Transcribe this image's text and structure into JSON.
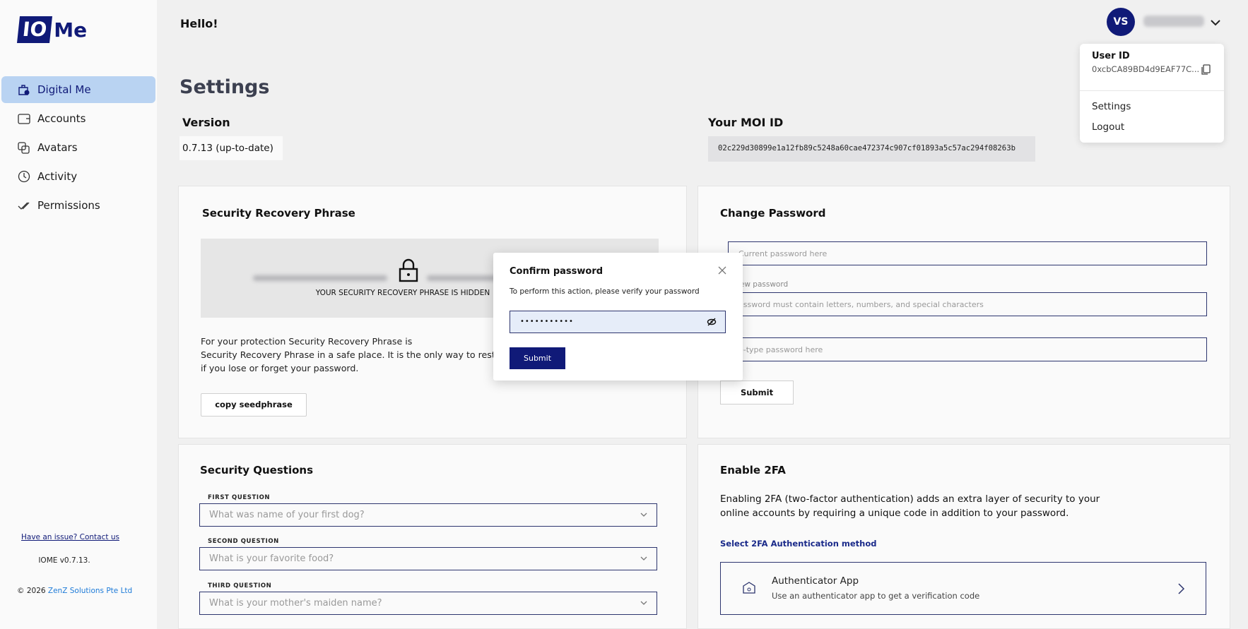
{
  "brand": {
    "logo_box": "IO",
    "logo_text": "Me"
  },
  "sidebar": {
    "items": [
      {
        "label": "Digital Me",
        "icon": "digital-me-icon",
        "active": true
      },
      {
        "label": "Accounts",
        "icon": "wallet-icon"
      },
      {
        "label": "Avatars",
        "icon": "avatars-icon"
      },
      {
        "label": "Activity",
        "icon": "clock-icon"
      },
      {
        "label": "Permissions",
        "icon": "check-icon"
      }
    ],
    "contact": "Have an issue? Contact us",
    "version": "IOME v0.7.13.",
    "copyright_prefix": "© 2026 ",
    "company": "ZenZ Solutions Pte Ltd"
  },
  "header": {
    "greeting": "Hello!",
    "avatar_initials": "VS"
  },
  "user_menu": {
    "id_label": "User ID",
    "id_value": "0xcbCA89BD4d9EAF77C...",
    "items": [
      "Settings",
      "Logout"
    ]
  },
  "settings": {
    "title": "Settings",
    "version_label": "Version",
    "version_value": "0.7.13 (up-to-date)",
    "moi_label": "Your MOI ID",
    "moi_value": "02c229d30899e1a12fb89c5248a60cae472374c907cf01893a5c57ac294f08263b"
  },
  "recovery": {
    "title": "Security Recovery Phrase",
    "hidden_label": "YOUR SECURITY RECOVERY PHRASE IS HIDDEN",
    "text_line1": "For your protection Security Recovery Phrase is",
    "text_line2": "Security Recovery Phrase in a safe place. It is the only way to restore yo",
    "text_line3": "if you lose or forget your password.",
    "copy_button": "copy seedphrase"
  },
  "change_password": {
    "title": "Change Password",
    "current_placeholder": "Current password here",
    "new_label": "lew password",
    "new_placeholder": "assword must contain letters, numbers, and special characters",
    "retype_placeholder": "e-type password here",
    "submit": "Submit"
  },
  "questions": {
    "title": "Security Questions",
    "items": [
      {
        "label": "FIRST QUESTION",
        "value": "What was name of your first dog?"
      },
      {
        "label": "SECOND QUESTION",
        "value": "What is your favorite food?"
      },
      {
        "label": "THIRD QUESTION",
        "value": "What is your mother's maiden name?"
      }
    ]
  },
  "twofa": {
    "title": "Enable 2FA",
    "description": "Enabling 2FA (two-factor authentication) adds an extra layer of security to your online accounts by requiring a unique code in addition to your password.",
    "method_link": "Select 2FA Authentication method",
    "app_title": "Authenticator App",
    "app_sub": "Use an authenticator app to get a verification code"
  },
  "modal": {
    "title": "Confirm password",
    "subtitle": "To perform this action, please verify your password",
    "password_mask": "•••••••••••",
    "submit": "Submit"
  },
  "colors": {
    "brand": "#101a78",
    "active_nav": "#b9d3f2",
    "link": "#1e7bd8"
  }
}
